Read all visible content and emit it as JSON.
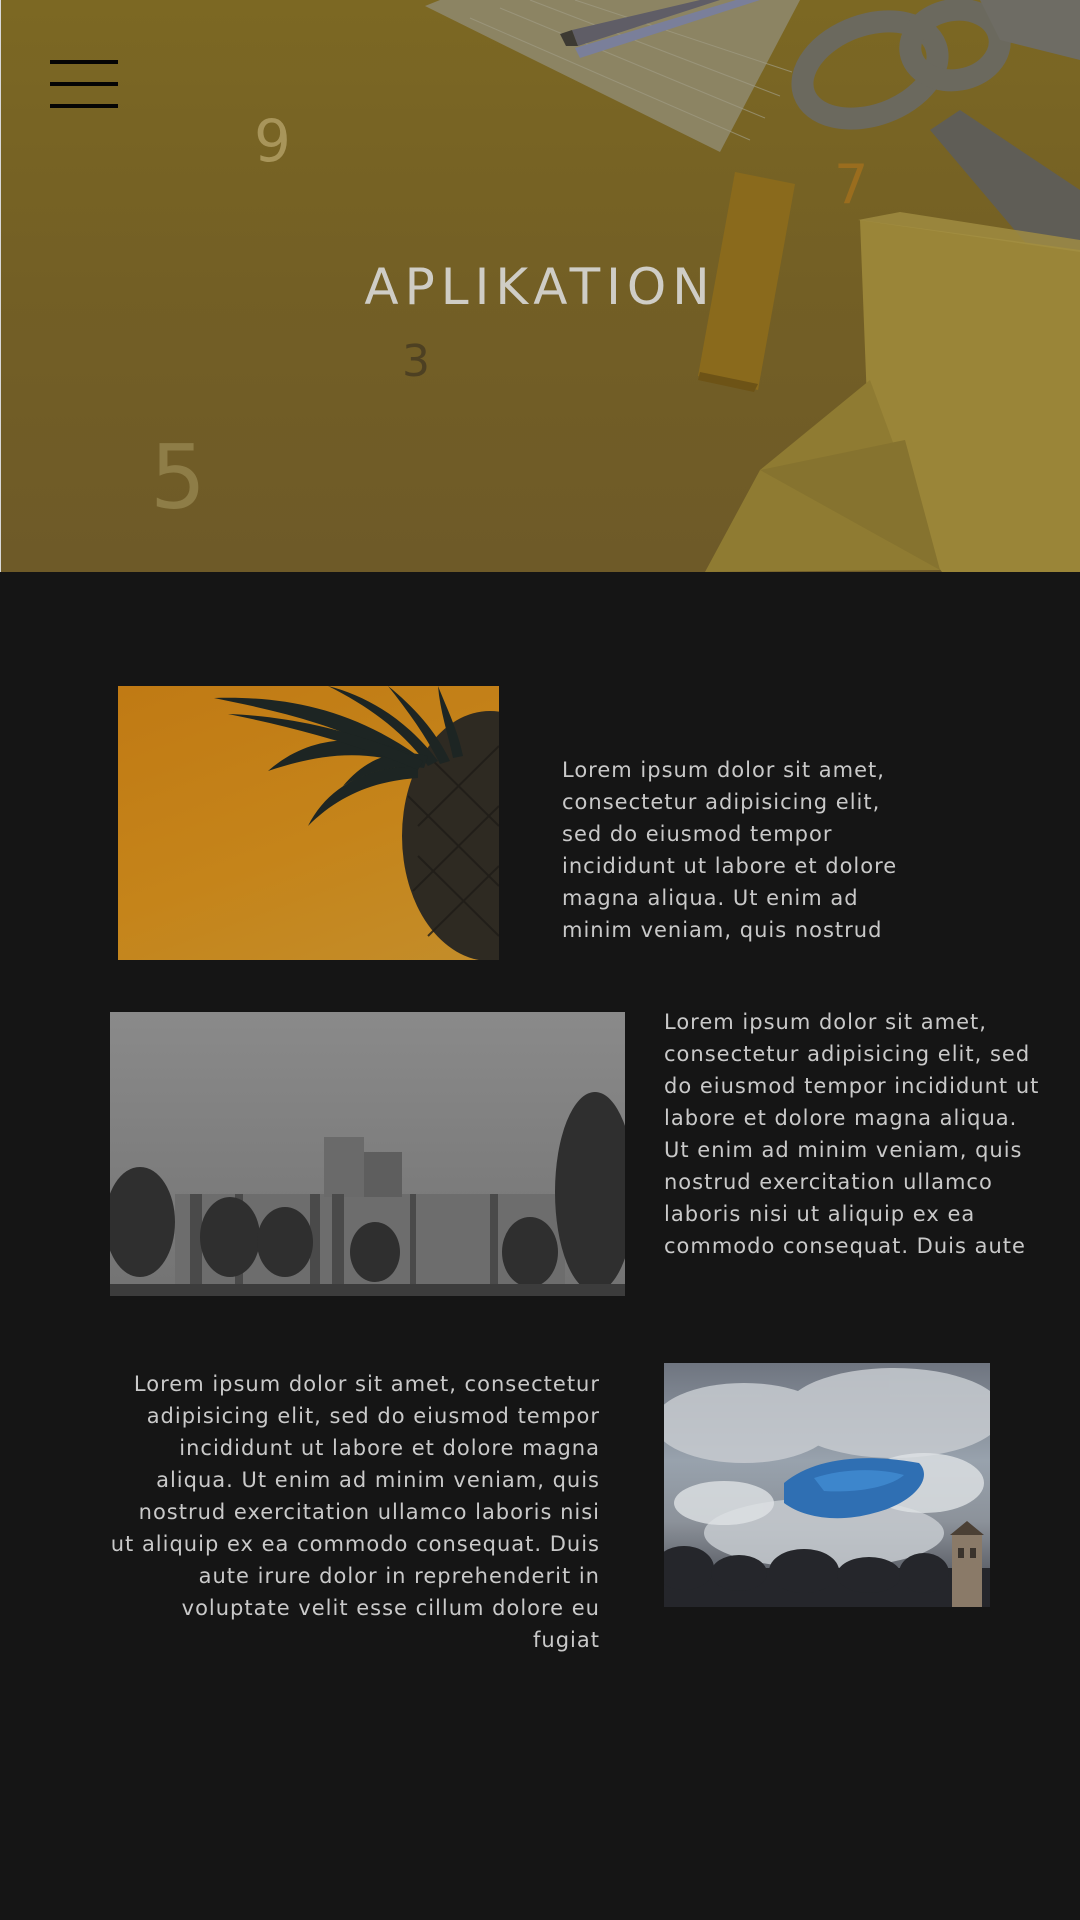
{
  "hero": {
    "title": "APLIKATION",
    "numbers": {
      "n9": "9",
      "n7": "7",
      "n3": "3",
      "n5": "5"
    },
    "menu_icon": "hamburger-menu-icon",
    "background_color": "#7a6624"
  },
  "content": {
    "background_color": "#151515",
    "text_color": "#c9c9c9",
    "rows": [
      {
        "text": "Lorem ipsum dolor sit amet, consectetur adipisicing elit, sed do eiusmod tempor incididunt ut labore et dolore magna aliqua. Ut enim ad minim veniam, quis nostrud",
        "image": "pineapple-on-orange-photo"
      },
      {
        "text": "Lorem ipsum dolor sit amet, consectetur adipisicing elit, sed do eiusmod tempor incididunt ut labore et dolore magna aliqua. Ut enim ad minim veniam, quis nostrud exercitation ullamco laboris nisi ut aliquip ex ea commodo consequat. Duis aute",
        "image": "grayscale-building-photo"
      },
      {
        "text": "Lorem ipsum dolor sit amet, consectetur adipisicing elit, sed do eiusmod tempor incididunt ut labore et dolore magna aliqua. Ut enim ad minim veniam, quis nostrud exercitation ullamco laboris nisi ut aliquip ex ea commodo consequat. Duis aute irure dolor in reprehenderit in voluptate velit esse cillum dolore eu fugiat",
        "image": "cloudy-sky-photo"
      }
    ]
  }
}
